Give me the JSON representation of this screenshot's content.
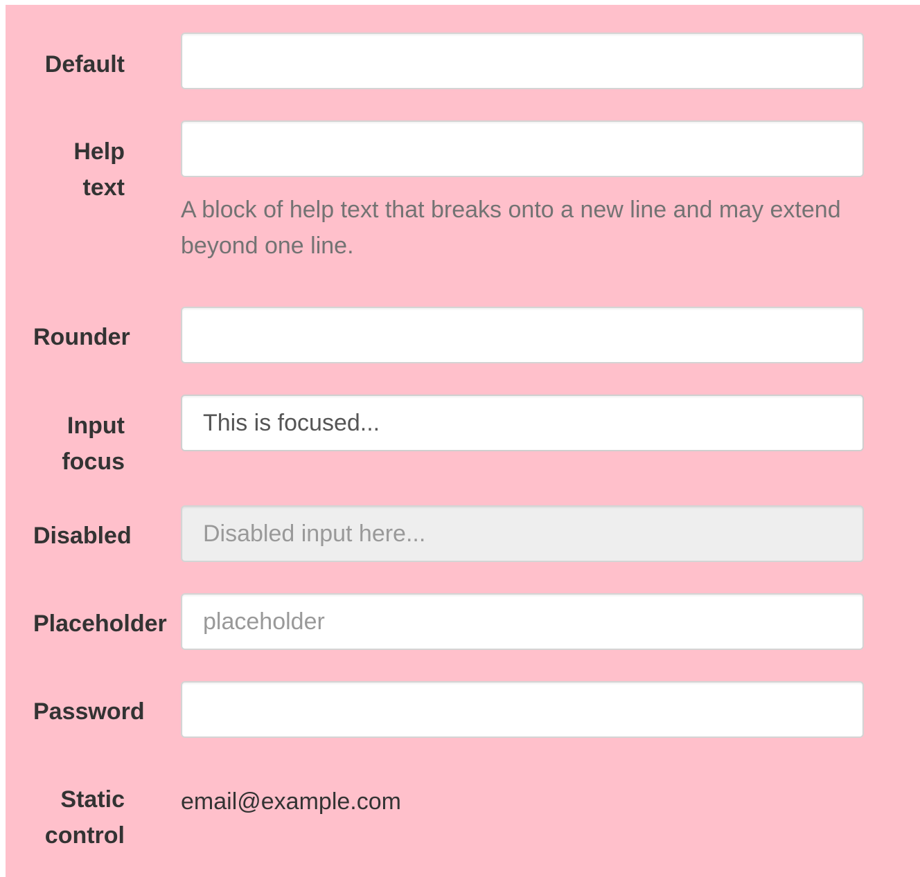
{
  "form": {
    "default": {
      "label": "Default",
      "value": ""
    },
    "help_text": {
      "label_line1": "Help",
      "label_line2": "text",
      "value": "",
      "help": "A block of help text that breaks onto a new line and may extend beyond one line."
    },
    "rounder": {
      "label": "Rounder",
      "value": ""
    },
    "input_focus": {
      "label_line1": "Input",
      "label_line2": "focus",
      "value": "This is focused..."
    },
    "disabled": {
      "label": "Disabled",
      "placeholder": "Disabled input here..."
    },
    "placeholder": {
      "label": "Placeholder",
      "placeholder": "placeholder"
    },
    "password": {
      "label": "Password",
      "value": ""
    },
    "static_control": {
      "label_line1": "Static",
      "label_line2": "control",
      "value": "email@example.com"
    }
  },
  "colors": {
    "panel_background": "#ffc0cb",
    "label_text": "#333333",
    "help_text": "#737373",
    "disabled_background": "#eeeeee",
    "input_border": "#d4d4d4"
  }
}
